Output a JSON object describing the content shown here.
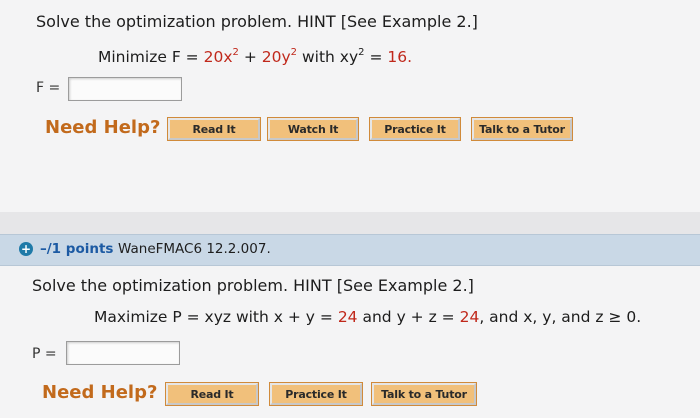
{
  "q1": {
    "prompt": "Solve the optimization problem. HINT [See Example 2.]",
    "minimize_label": "Minimize F =",
    "term1_coef": "20x",
    "exp2": "2",
    "plus": "+",
    "term2_coef": "20y",
    "with_text": "with xy",
    "equals": "=",
    "constraint_value": "16.",
    "answer_label": "F =",
    "answer_value": "",
    "need_help": "Need Help?",
    "buttons": [
      "Read It",
      "Watch It",
      "Practice It",
      "Talk to a Tutor"
    ]
  },
  "q2": {
    "points": "–/1 points",
    "code": "WaneFMAC6 12.2.007.",
    "prompt": "Solve the optimization problem. HINT [See Example 2.]",
    "maximize_label": "Maximize P = xyz with x + y =",
    "val1": "24",
    "mid_text": "and y + z =",
    "val2": "24",
    "tail_text": ", and x, y, and z ≥ 0.",
    "answer_label": "P =",
    "answer_value": "",
    "need_help": "Need Help?",
    "buttons": [
      "Read It",
      "Practice It",
      "Talk to a Tutor"
    ]
  },
  "colors": {
    "accent_red": "#c0281b",
    "need_help_orange": "#c26a1c",
    "button_fill": "#f1c07b",
    "header_bar": "#c9d8e6",
    "points_blue": "#1c5aa3"
  }
}
